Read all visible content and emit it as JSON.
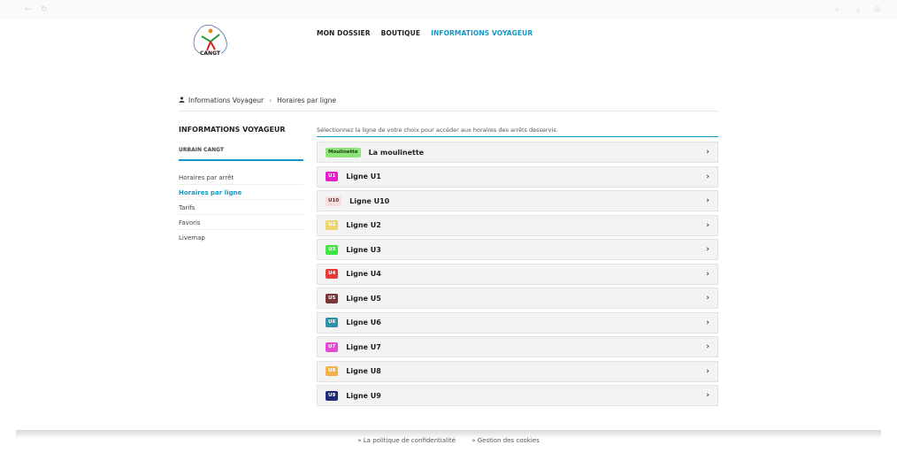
{
  "nav": {
    "items": [
      {
        "label": "MON DOSSIER",
        "active": false
      },
      {
        "label": "BOUTIQUE",
        "active": false
      },
      {
        "label": "INFORMATIONS VOYAGEUR",
        "active": true
      }
    ]
  },
  "logo": {
    "text": "CANGT"
  },
  "breadcrumb": {
    "home": "Informations Voyageur",
    "separator": "›",
    "current": "Horaires par ligne"
  },
  "sidebar": {
    "title": "INFORMATIONS VOYAGEUR",
    "subtitle": "URBAIN CANGT",
    "items": [
      {
        "label": "Horaires par arrêt"
      },
      {
        "label": "Horaires par ligne"
      },
      {
        "label": "Tarifs"
      },
      {
        "label": "Favoris"
      },
      {
        "label": "Livemap"
      }
    ]
  },
  "main": {
    "intro": "Sélectionnez la ligne de votre choix pour accéder aux horaires des arrêts desservis.",
    "lines": [
      {
        "badge": "Moulinette",
        "name": "La moulinette",
        "color": "#8ee37a",
        "text_color": "#1f3d12"
      },
      {
        "badge": "U1",
        "name": "Ligne U1",
        "color": "#e51ecd",
        "text_color": "#ffffff"
      },
      {
        "badge": "U10",
        "name": "Ligne U10",
        "color": "#f6dede",
        "text_color": "#6a3030"
      },
      {
        "badge": "U2",
        "name": "Ligne U2",
        "color": "#ecd56a",
        "text_color": "#ffffff"
      },
      {
        "badge": "U3",
        "name": "Ligne U3",
        "color": "#3fe63f",
        "text_color": "#ffffff"
      },
      {
        "badge": "U4",
        "name": "Ligne U4",
        "color": "#e53a3a",
        "text_color": "#ffffff"
      },
      {
        "badge": "U5",
        "name": "Ligne U5",
        "color": "#7a3434",
        "text_color": "#ffffff"
      },
      {
        "badge": "U6",
        "name": "Ligne U6",
        "color": "#2d8fa8",
        "text_color": "#ffffff"
      },
      {
        "badge": "U7",
        "name": "Ligne U7",
        "color": "#e14ad4",
        "text_color": "#ffffff"
      },
      {
        "badge": "U8",
        "name": "Ligne U8",
        "color": "#f2b24a",
        "text_color": "#ffffff"
      },
      {
        "badge": "U9",
        "name": "Ligne U9",
        "color": "#1f2a7a",
        "text_color": "#ffffff"
      }
    ]
  },
  "footer": {
    "links": [
      {
        "label": "» La politique de confidentialité"
      },
      {
        "label": "» Gestion des cookies"
      }
    ]
  },
  "theme": {
    "accent": "#1597c4"
  }
}
